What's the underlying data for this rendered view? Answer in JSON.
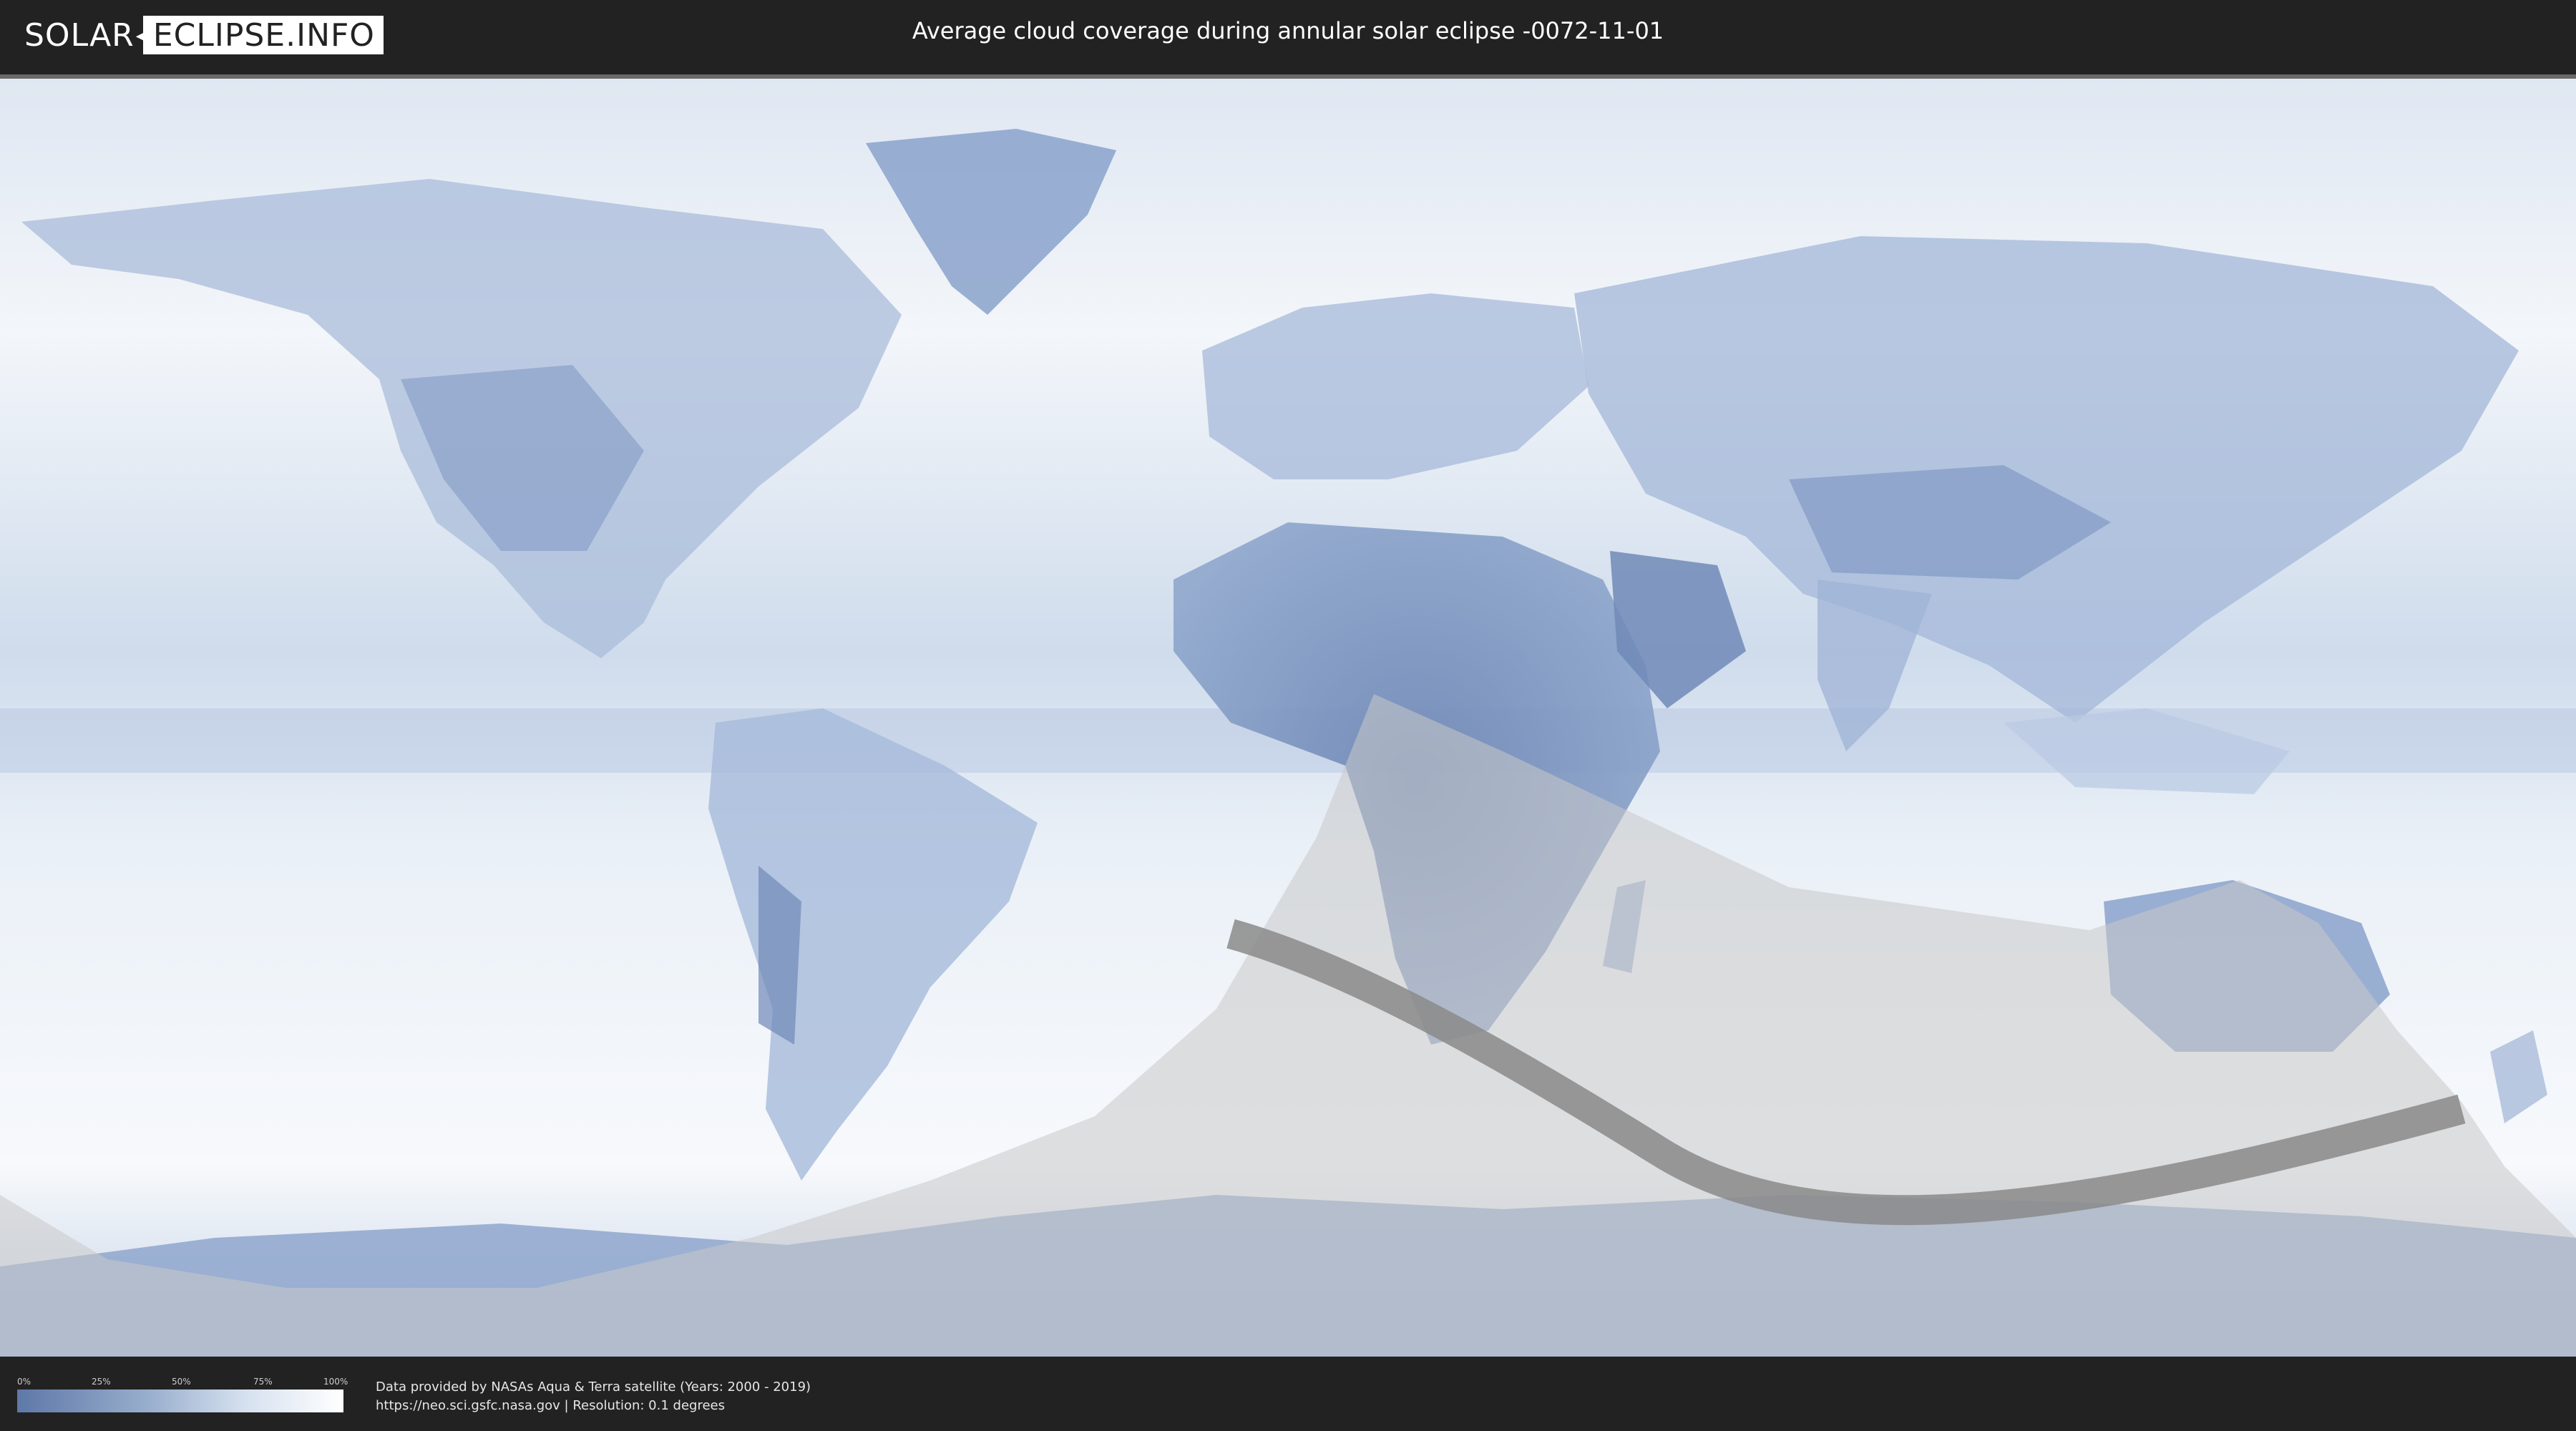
{
  "header": {
    "logo_left": "SOLAR",
    "logo_right": "ECLIPSE.INFO",
    "title": "Average cloud coverage during annular solar eclipse -0072-11-01"
  },
  "legend": {
    "ticks": [
      "0%",
      "25%",
      "50%",
      "75%",
      "100%"
    ],
    "colors": {
      "low": "#5e78a8",
      "high": "#ffffff"
    }
  },
  "footer": {
    "line1": "Data provided by NASAs Aqua & Terra satellite (Years: 2000 - 2019)",
    "line2": "https://neo.sci.gsfc.nasa.gov | Resolution: 0.1 degrees"
  },
  "map": {
    "ocean_color": "#e4ecf5",
    "land_color": "#7f98c3",
    "penumbra_color": "#c9c9c9",
    "path_color": "#8a8a8a"
  }
}
